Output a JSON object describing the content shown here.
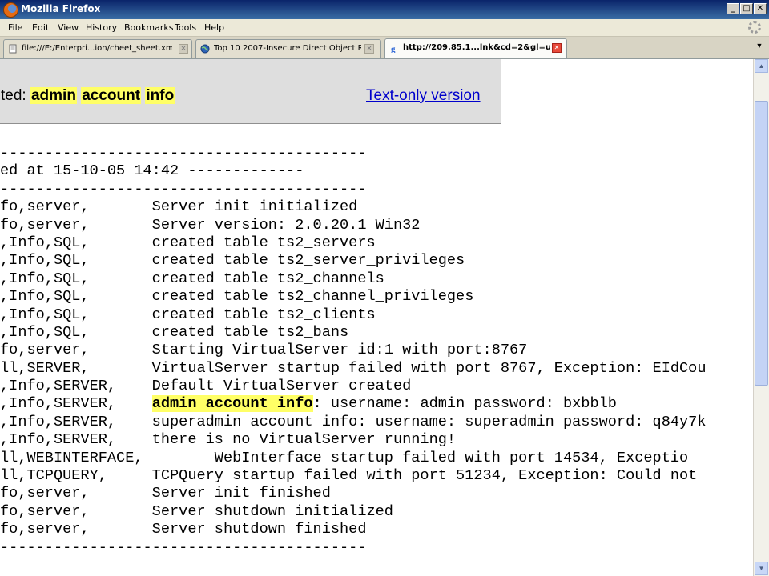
{
  "window": {
    "title": "Mozilla Firefox"
  },
  "menu": {
    "file": "File",
    "edit": "Edit",
    "view": "View",
    "history": "History",
    "bookmarks": "Bookmarks",
    "tools": "Tools",
    "help": "Help"
  },
  "tabs": [
    {
      "label": "file:///E:/Enterpri...ion/cheet_sheet.xml",
      "icon": "document-icon",
      "active": false
    },
    {
      "label": "Top 10 2007-Insecure Direct Object R...",
      "icon": "globe-icon",
      "active": false
    },
    {
      "label": "http://209.85.1...lnk&cd=2&gl=us",
      "icon": "google-icon",
      "active": true
    }
  ],
  "banner": {
    "prefix": "ted: ",
    "terms": [
      "admin",
      "account",
      "info"
    ],
    "text_only_link": "Text-only version"
  },
  "log_lines": [
    "-----------------------------------------",
    "ed at 15-10-05 14:42 -------------",
    "-----------------------------------------",
    "fo,server,       Server init initialized",
    "fo,server,       Server version: 2.0.20.1 Win32",
    ",Info,SQL,       created table ts2_servers",
    ",Info,SQL,       created table ts2_server_privileges",
    ",Info,SQL,       created table ts2_channels",
    ",Info,SQL,       created table ts2_channel_privileges",
    ",Info,SQL,       created table ts2_clients",
    ",Info,SQL,       created table ts2_bans",
    "fo,server,       Starting VirtualServer id:1 with port:8767",
    "ll,SERVER,       VirtualServer startup failed with port 8767, Exception: EIdCou",
    ",Info,SERVER,    Default VirtualServer created",
    "HIGHLIGHT",
    ",Info,SERVER,    superadmin account info: username: superadmin password: q84y7k",
    ",Info,SERVER,    there is no VirtualServer running!",
    "ll,WEBINTERFACE,        WebInterface startup failed with port 14534, Exceptio",
    "ll,TCPQUERY,     TCPQuery startup failed with port 51234, Exception: Could not",
    "fo,server,       Server init finished",
    "fo,server,       Server shutdown initialized",
    "fo,server,       Server shutdown finished",
    "-----------------------------------------"
  ],
  "highlight_line": {
    "prefix": ",Info,SERVER,    ",
    "highlight": "admin account info",
    "suffix": ": username: admin password: bxbblb"
  },
  "colors": {
    "highlight": "#ffff66",
    "link": "#0000cc"
  }
}
